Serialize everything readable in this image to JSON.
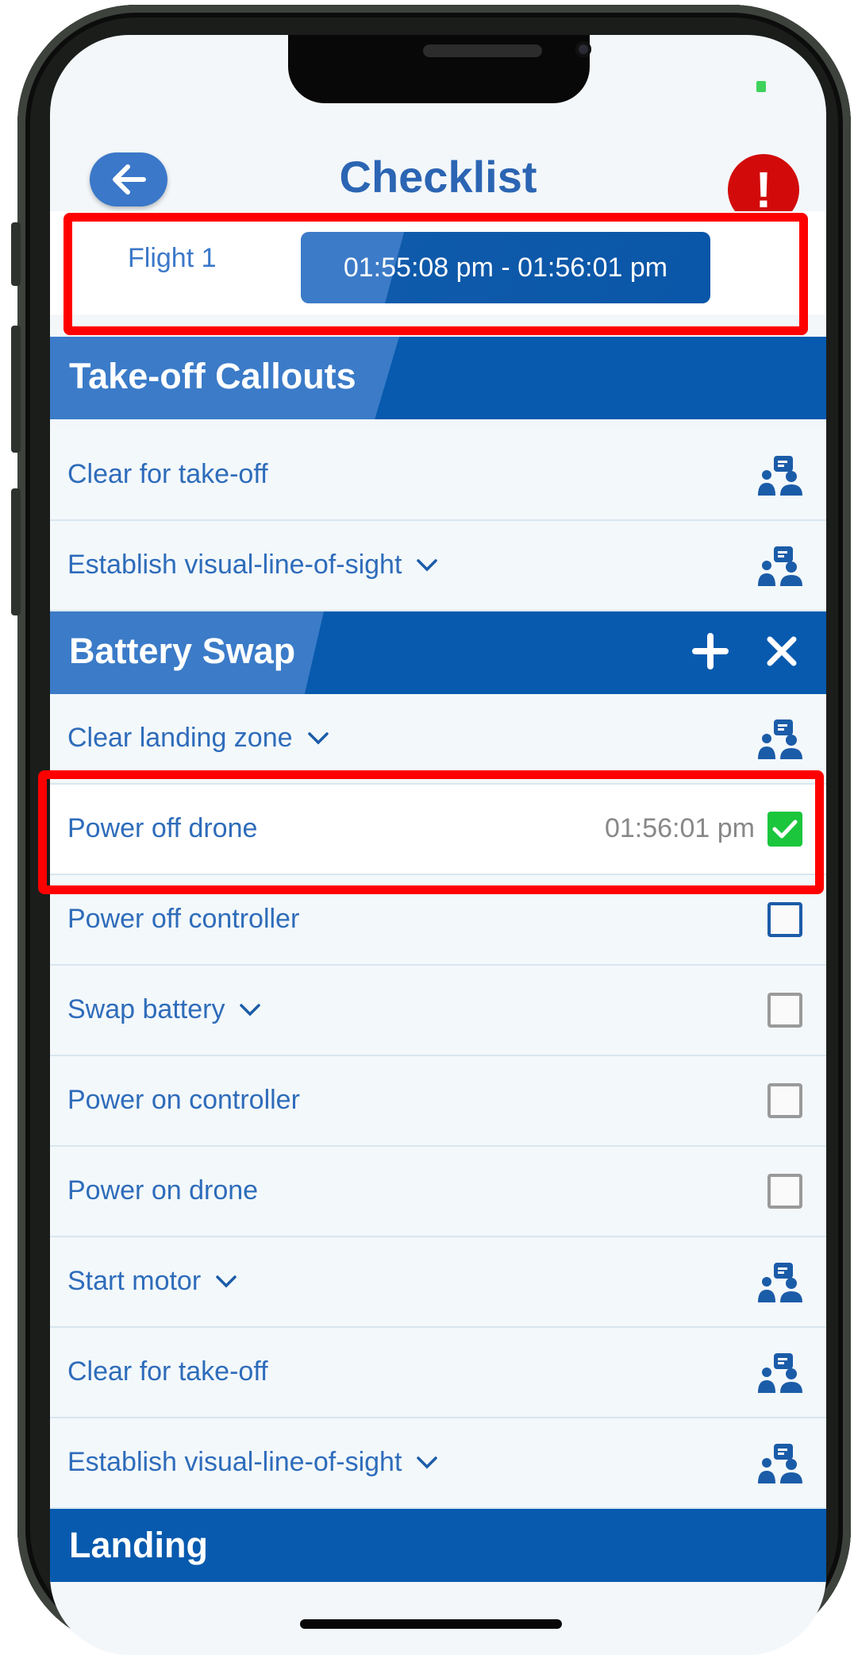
{
  "header": {
    "title": "Checklist",
    "back_icon": "arrow-left-icon",
    "alert_icon": "exclamation-icon",
    "alert_glyph": "!"
  },
  "flight": {
    "label": "Flight 1",
    "time_range": "01:55:08 pm - 01:56:01 pm"
  },
  "sections": [
    {
      "title": "Take-off Callouts",
      "items": [
        {
          "label": "Clear for take-off",
          "expandable": false,
          "control": "callout"
        },
        {
          "label": "Establish visual-line-of-sight",
          "expandable": true,
          "control": "callout"
        }
      ]
    },
    {
      "title": "Battery Swap",
      "actions": {
        "add_icon": "plus-icon",
        "remove_icon": "close-icon"
      },
      "items": [
        {
          "label": "Clear landing zone",
          "expandable": true,
          "control": "callout"
        },
        {
          "label": "Power off drone",
          "expandable": false,
          "control": "checkbox",
          "checked": true,
          "time": "01:56:01 pm"
        },
        {
          "label": "Power off controller",
          "expandable": false,
          "control": "checkbox",
          "checked": false
        },
        {
          "label": "Swap battery",
          "expandable": true,
          "control": "checkbox",
          "checked": false
        },
        {
          "label": "Power on controller",
          "expandable": false,
          "control": "checkbox",
          "checked": false
        },
        {
          "label": "Power on drone",
          "expandable": false,
          "control": "checkbox",
          "checked": false
        },
        {
          "label": "Start motor",
          "expandable": true,
          "control": "callout"
        },
        {
          "label": "Clear for take-off",
          "expandable": false,
          "control": "callout"
        },
        {
          "label": "Establish visual-line-of-sight",
          "expandable": true,
          "control": "callout"
        }
      ]
    },
    {
      "title": "Landing"
    }
  ],
  "colors": {
    "brand_blue": "#075aae",
    "light_blue": "#3b7bc8",
    "alert_red": "#d20a0a",
    "check_green": "#1bc63c",
    "highlight_red": "#ff0000"
  }
}
